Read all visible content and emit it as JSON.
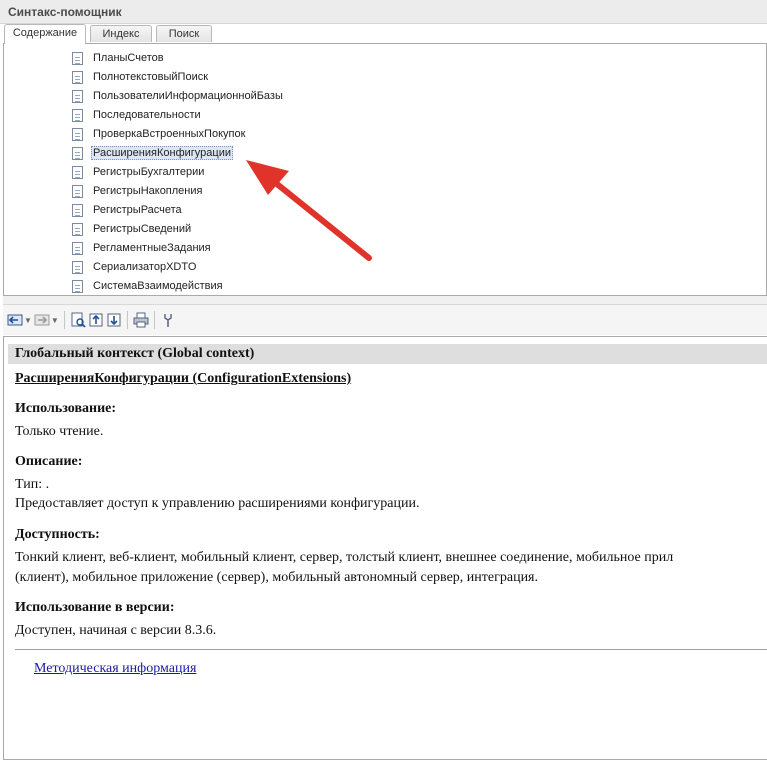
{
  "window": {
    "title": "Синтакс-помощник"
  },
  "tabs": [
    {
      "label": "Содержание",
      "active": true
    },
    {
      "label": "Индекс",
      "active": false
    },
    {
      "label": "Поиск",
      "active": false
    }
  ],
  "tree": {
    "items": [
      {
        "label": "ПланыСчетов"
      },
      {
        "label": "ПолнотекстовыйПоиск"
      },
      {
        "label": "ПользователиИнформационнойБазы"
      },
      {
        "label": "Последовательности"
      },
      {
        "label": "ПроверкаВстроенныхПокупок"
      },
      {
        "label": "РасширенияКонфигурации",
        "selected": true
      },
      {
        "label": "РегистрыБухгалтерии"
      },
      {
        "label": "РегистрыНакопления"
      },
      {
        "label": "РегистрыРасчета"
      },
      {
        "label": "РегистрыСведений"
      },
      {
        "label": "РегламентныеЗадания"
      },
      {
        "label": "СериализаторXDTO"
      },
      {
        "label": "СистемаВзаимодействия"
      }
    ]
  },
  "toolbar": {
    "icons": [
      "back-icon",
      "forward-icon",
      "find-in-tree-icon",
      "up-level-icon",
      "sync-icon",
      "print-icon",
      "settings-icon"
    ]
  },
  "content": {
    "context": "Глобальный контекст (Global context)",
    "topic_title": "РасширенияКонфигурации (ConfigurationExtensions)",
    "usage_heading": "Использование:",
    "usage_text": "Только чтение.",
    "description_heading": "Описание:",
    "type_text": "Тип: .",
    "description_text": "Предоставляет доступ к управлению расширениями конфигурации.",
    "availability_heading": "Доступность:",
    "availability_line1": "Тонкий клиент, веб-клиент, мобильный клиент, сервер, толстый клиент, внешнее соединение, мобильное прил",
    "availability_line2": "(клиент), мобильное приложение (сервер), мобильный автономный сервер, интеграция.",
    "version_heading": "Использование в версии:",
    "version_text": "Доступен, начиная с версии 8.3.6.",
    "method_link": "Методическая информация"
  },
  "colors": {
    "annotation_arrow": "#e0342b",
    "link": "#1a1aa6",
    "selection": "#dde6f7"
  }
}
